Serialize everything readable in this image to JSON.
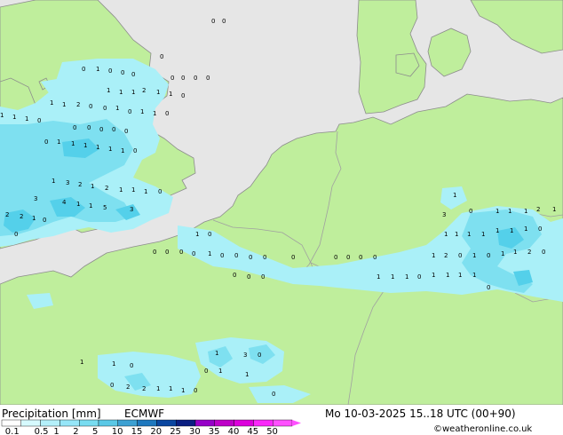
{
  "title_left": "Precipitation [mm]",
  "model": "ECMWF",
  "valid_time": "Mo 10-03-2025 15..18 UTC (00+90)",
  "credit": "©weatheronline.co.uk",
  "colors": {
    "sea": "#e6e6e6",
    "land": "#bfee9c",
    "coast": "#8c8c8c",
    "border": "#a0a0a0",
    "rain_light": "#aaf0f8",
    "rain_mid": "#7ee0f0",
    "rain_heavy": "#54d0ea"
  },
  "legend": {
    "labels": [
      "0.1",
      "0.5",
      "1",
      "2",
      "5",
      "10",
      "15",
      "20",
      "25",
      "30",
      "35",
      "40",
      "45",
      "50"
    ],
    "colors": [
      "#ffffff",
      "#d6fafe",
      "#b4f0fa",
      "#96e6f8",
      "#78dcf0",
      "#5ac8e6",
      "#3ca0d2",
      "#1e78be",
      "#0a46a0",
      "#0a1e82",
      "#9600c8",
      "#be00c8",
      "#dc00dc",
      "#fa28fa",
      "#ff50ff"
    ]
  },
  "map_labels": [
    "0",
    "0",
    "0",
    "0",
    "1",
    "0",
    "0",
    "0",
    "0",
    "0",
    "0",
    "0",
    "1",
    "1",
    "1",
    "2",
    "1",
    "1",
    "0",
    "1",
    "1",
    "2",
    "0",
    "0",
    "1",
    "0",
    "1",
    "1",
    "0",
    "1",
    "1",
    "1",
    "0",
    "0",
    "0",
    "0",
    "0",
    "0",
    "0",
    "1",
    "1",
    "1",
    "1",
    "1",
    "1",
    "0",
    "1",
    "3",
    "2",
    "1",
    "2",
    "1",
    "1",
    "1",
    "0",
    "3",
    "4",
    "1",
    "1",
    "5",
    "3",
    "2",
    "2",
    "1",
    "0",
    "0",
    "1",
    "0",
    "0",
    "0",
    "0",
    "0",
    "1",
    "0",
    "0",
    "0",
    "0",
    "0",
    "0",
    "0",
    "0",
    "0",
    "0",
    "0",
    "0",
    "1",
    "0",
    "1",
    "1",
    "1",
    "2",
    "3",
    "1",
    "1",
    "1",
    "1",
    "1",
    "1",
    "1",
    "1",
    "0",
    "1",
    "2",
    "0",
    "1",
    "0",
    "1",
    "1",
    "2",
    "0",
    "1",
    "1",
    "1",
    "0",
    "1",
    "1",
    "1",
    "1",
    "0",
    "1",
    "1",
    "0",
    "1",
    "3",
    "0",
    "0",
    "1",
    "1",
    "0",
    "2",
    "2",
    "1",
    "1",
    "1",
    "0",
    "0"
  ]
}
